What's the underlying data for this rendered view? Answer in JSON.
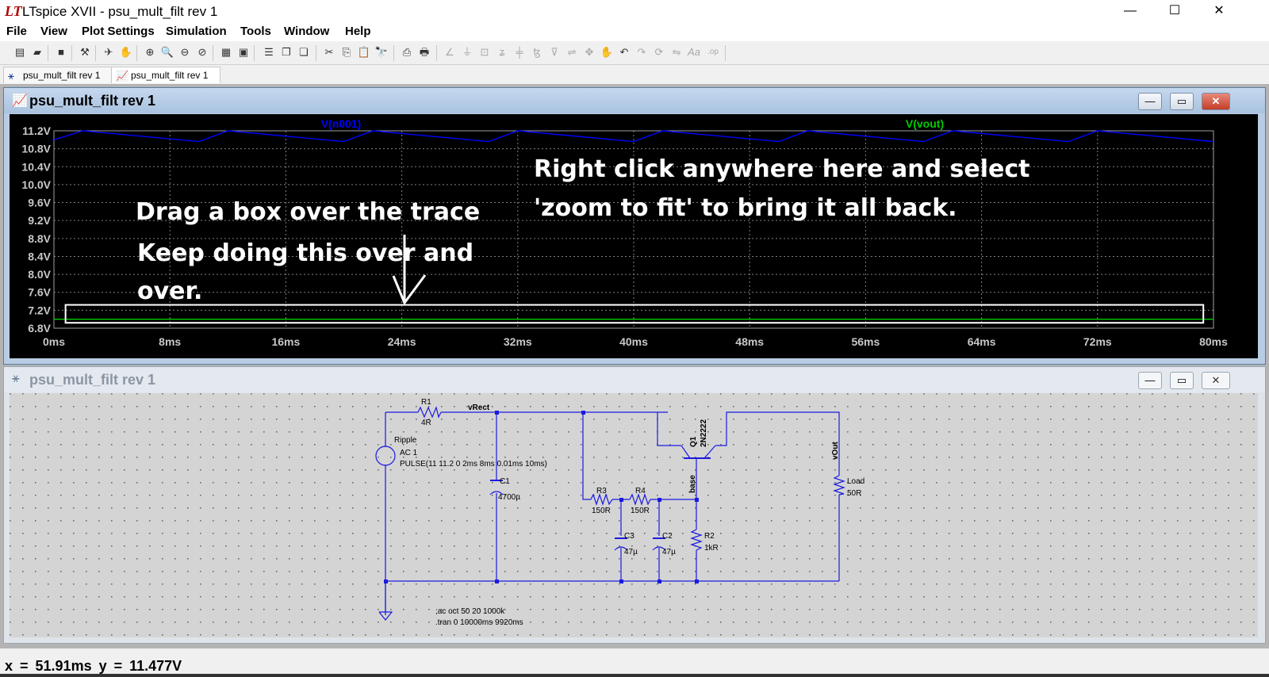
{
  "window": {
    "title": "LTspice XVII - psu_mult_filt rev 1",
    "logo": "LT",
    "minimize": "—",
    "maximize": "☐",
    "close": "✕"
  },
  "menu": [
    "File",
    "View",
    "Plot Settings",
    "Simulation",
    "Tools",
    "Window",
    "Help"
  ],
  "toolbar": [
    {
      "icon": "new-schematic-icon",
      "glyph": "▤"
    },
    {
      "icon": "open-icon",
      "glyph": "▰"
    },
    {
      "icon": "save-icon",
      "glyph": "■"
    },
    {
      "icon": "control-panel-icon",
      "glyph": "⚒"
    },
    {
      "icon": "run-icon",
      "glyph": "✈"
    },
    {
      "icon": "halt-icon",
      "glyph": "✋"
    },
    {
      "icon": "zoom-area-icon",
      "glyph": "⊕"
    },
    {
      "icon": "zoom-in-icon",
      "glyph": "🔍"
    },
    {
      "icon": "zoom-out-icon",
      "glyph": "⊖"
    },
    {
      "icon": "zoom-cancel-icon",
      "glyph": "⊘"
    },
    {
      "icon": "autorange-icon",
      "glyph": "▦"
    },
    {
      "icon": "fit-icon",
      "glyph": "▣"
    },
    {
      "icon": "tile-horizontal-icon",
      "glyph": "☰"
    },
    {
      "icon": "cascade-icon",
      "glyph": "❐"
    },
    {
      "icon": "tile-vertical-icon",
      "glyph": "❏"
    },
    {
      "icon": "cut-icon",
      "glyph": "✂"
    },
    {
      "icon": "copy-icon",
      "glyph": "⎘"
    },
    {
      "icon": "paste-icon",
      "glyph": "📋"
    },
    {
      "icon": "find-icon",
      "glyph": "🔭"
    },
    {
      "icon": "print-preview-icon",
      "glyph": "⎙"
    },
    {
      "icon": "print-icon",
      "glyph": "🖶"
    },
    {
      "icon": "wire-icon",
      "glyph": "∠",
      "disabled": true
    },
    {
      "icon": "ground-icon",
      "glyph": "⏚",
      "disabled": true
    },
    {
      "icon": "label-net-icon",
      "glyph": "⊡",
      "disabled": true
    },
    {
      "icon": "resistor-icon",
      "glyph": "ʑ",
      "disabled": true
    },
    {
      "icon": "capacitor-icon",
      "glyph": "╪",
      "disabled": true
    },
    {
      "icon": "inductor-icon",
      "glyph": "ꜩ",
      "disabled": true
    },
    {
      "icon": "diode-icon",
      "glyph": "⊽",
      "disabled": true
    },
    {
      "icon": "component-icon",
      "glyph": "⇌",
      "disabled": true
    },
    {
      "icon": "move-icon",
      "glyph": "✥",
      "disabled": true
    },
    {
      "icon": "drag-icon",
      "glyph": "✋",
      "disabled": true
    },
    {
      "icon": "undo-icon",
      "glyph": "↶"
    },
    {
      "icon": "redo-icon",
      "glyph": "↷",
      "disabled": true
    },
    {
      "icon": "rotate-icon",
      "glyph": "⟳",
      "disabled": true
    },
    {
      "icon": "mirror-icon",
      "glyph": "⇋",
      "disabled": true
    },
    {
      "icon": "text-icon",
      "glyph": "Aa",
      "disabled": true
    },
    {
      "icon": "spice-directive-icon",
      "glyph": ".op",
      "disabled": true
    }
  ],
  "tabs": [
    {
      "label": "psu_mult_filt rev 1",
      "icon": "schematic-icon",
      "glyph": "⚹",
      "active": false
    },
    {
      "label": "psu_mult_filt rev 1",
      "icon": "waveform-icon",
      "glyph": "📈",
      "active": true
    }
  ],
  "plot_window": {
    "title": "psu_mult_filt rev 1",
    "annotation_drag_1": "Drag a box over the trace",
    "annotation_drag_2": "Keep doing this over and",
    "annotation_drag_3": "over.",
    "annotation_right_1": "Right click anywhere here and select",
    "annotation_right_2": "'zoom to fit' to bring it all back."
  },
  "chart_data": {
    "type": "line",
    "xlabel": "",
    "ylabel": "",
    "xlim": [
      0,
      80
    ],
    "ylim": [
      6.8,
      11.2
    ],
    "x_ticks": [
      "0ms",
      "8ms",
      "16ms",
      "24ms",
      "32ms",
      "40ms",
      "48ms",
      "56ms",
      "64ms",
      "72ms",
      "80ms"
    ],
    "y_ticks": [
      "11.2V",
      "10.8V",
      "10.4V",
      "10.0V",
      "9.6V",
      "9.2V",
      "8.8V",
      "8.4V",
      "8.0V",
      "7.6V",
      "7.2V",
      "6.8V"
    ],
    "grid": true,
    "series": [
      {
        "name": "V(n001)",
        "color": "#0000ff",
        "x": [
          0,
          2,
          10,
          12,
          20,
          22,
          30,
          32,
          40,
          42,
          50,
          52,
          60,
          62,
          70,
          72,
          80
        ],
        "y": [
          11.0,
          11.2,
          10.96,
          11.2,
          10.96,
          11.2,
          10.96,
          11.2,
          10.96,
          11.2,
          10.96,
          11.2,
          10.96,
          11.2,
          10.96,
          11.2,
          10.96
        ]
      },
      {
        "name": "V(vout)",
        "color": "#00cc00",
        "x": [
          0,
          80
        ],
        "y": [
          7.0,
          7.0
        ]
      }
    ]
  },
  "selection_box": {
    "x1": 0.8,
    "x2": 79.3,
    "y1": 7.32,
    "y2": 6.92
  },
  "schematic_window": {
    "title": "psu_mult_filt rev 1",
    "labels": {
      "r1": "R1",
      "r1v": "4R",
      "vrect": "vRect",
      "ripple": "Ripple",
      "ac": "AC 1",
      "pulse": "PULSE(11 11.2 0 2ms 8ms 0.01ms 10ms)",
      "c1": "C1",
      "c1v": "4700µ",
      "r3": "R3",
      "r3v": "150R",
      "r4": "R4",
      "r4v": "150R",
      "c3": "C3",
      "c3v": "47µ",
      "c2": "C2",
      "c2v": "47µ",
      "q1": "Q1",
      "q1v": "2N2222",
      "base": "base",
      "r2": "R2",
      "r2v": "1kR",
      "vout": "vOut",
      "load": "Load",
      "loadv": "50R",
      "ac_cmd": ";ac oct 50 20 1000k",
      "tran_cmd": ".tran 0 10000ms 9920ms"
    }
  },
  "status": "x = 51.91ms    y = 11.477V"
}
